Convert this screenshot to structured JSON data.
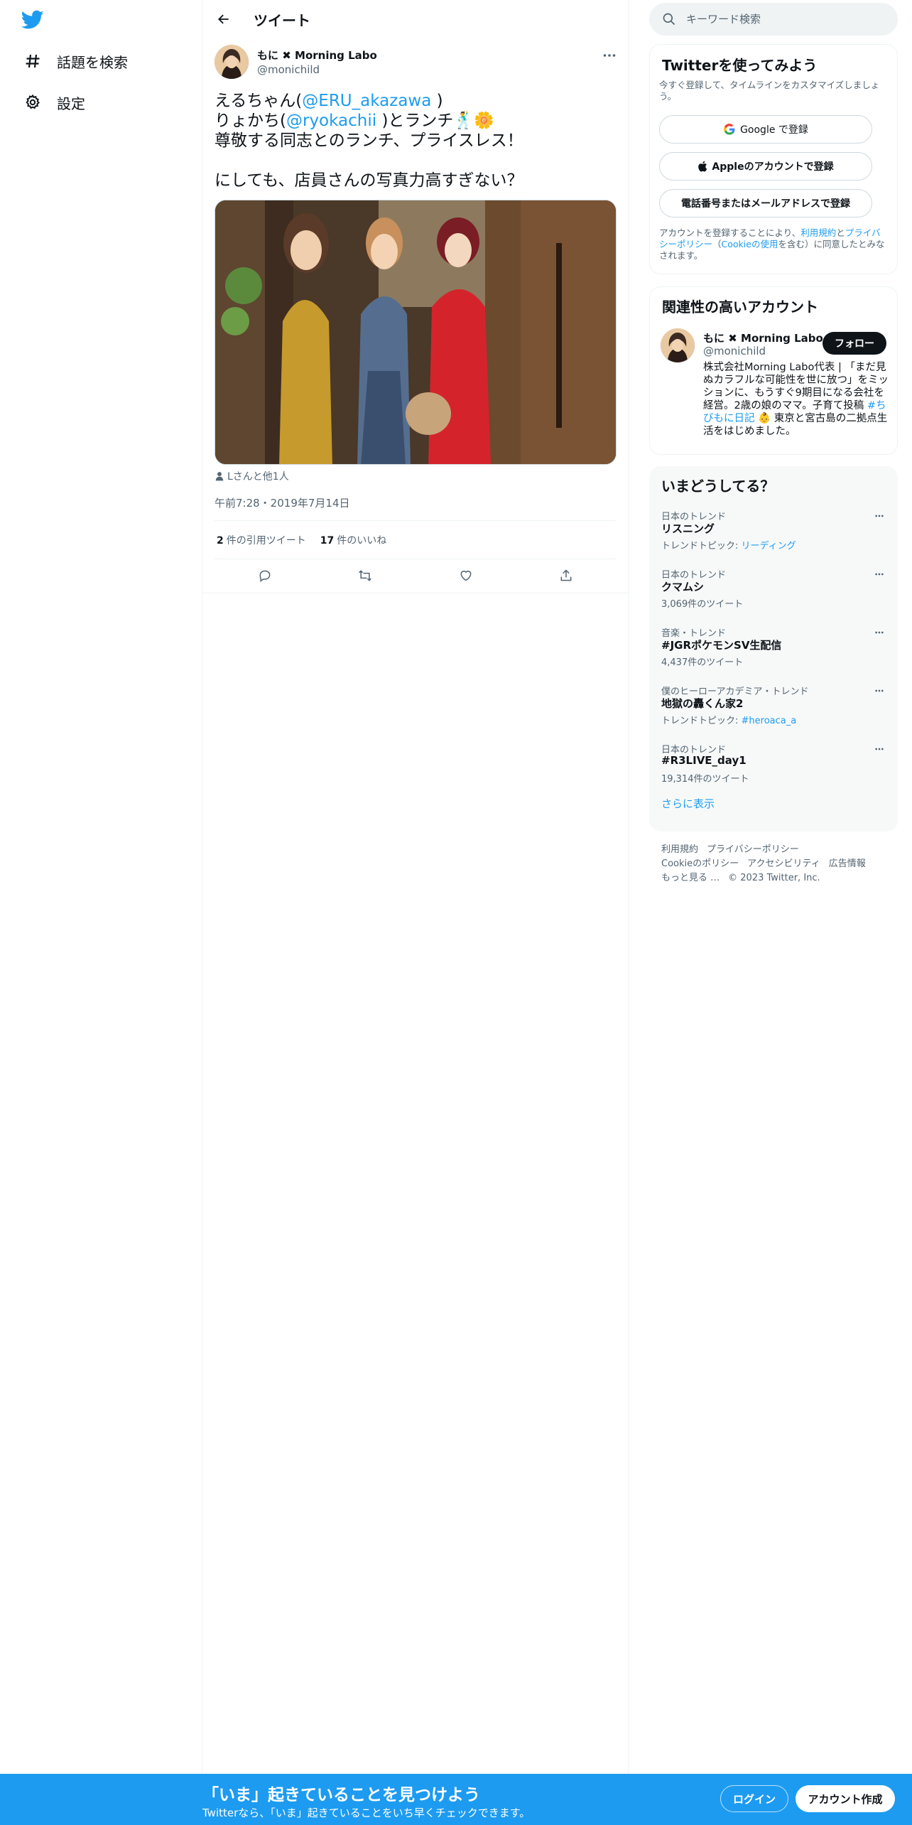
{
  "nav": {
    "logo": "twitter-bird-icon",
    "items": [
      {
        "label": "話題を検索",
        "icon": "hashtag-icon"
      },
      {
        "label": "設定",
        "icon": "gear-icon"
      }
    ]
  },
  "header": {
    "title": "ツイート"
  },
  "tweet": {
    "author_name": "もに ✖ Morning Labo",
    "author_handle": "@monichild",
    "text": {
      "l1_pre": "えるちゃん(",
      "l1_mention": "@ERU_akazawa",
      "l1_post": " )",
      "l2_pre": "りょかち(",
      "l2_mention": "@ryokachii",
      "l2_post": " )とランチ🕺🌼",
      "l3": "尊敬する同志とのランチ、プライスレス！",
      "l4": "にしても、店員さんの写真力高すぎない？"
    },
    "tagged": "Lさんと他1人",
    "timestamp": "午前7:28・2019年7月14日",
    "stats": {
      "quotes_count": "2",
      "quotes_label": "件の引用ツイート",
      "likes_count": "17",
      "likes_label": "件のいいね"
    }
  },
  "search": {
    "placeholder": "キーワード検索"
  },
  "signup_card": {
    "title": "Twitterを使ってみよう",
    "subtitle": "今すぐ登録して、タイムラインをカスタマイズしましょう。",
    "google_label": "Google で登録",
    "apple_label": "Appleのアカウントで登録",
    "phone_label": "電話番号またはメールアドレスで登録",
    "legal_pre": "アカウントを登録することにより、",
    "legal_terms": "利用規約",
    "legal_and": "と",
    "legal_privacy": "プライバシーポリシー",
    "legal_paren_open": "（",
    "legal_cookie": "Cookieの使用",
    "legal_post": "を含む）に同意したとみなされます。"
  },
  "related_card": {
    "title": "関連性の高いアカウント",
    "name": "もに ✖ Morning Labo",
    "handle": "@monichild",
    "follow_label": "フォロー",
    "bio_pre": "株式会社Morning Labo代表 | 「まだ見ぬカラフルな可能性を世に放つ」をミッションに、もうすぐ9期目になる会社を経営。2歳の娘のママ。子育て投稿 ",
    "bio_hashtag": "#ちびもに日記",
    "bio_post": " 👶 東京と宮古島の二拠点生活をはじめました。"
  },
  "trends_card": {
    "title": "いまどうしてる？",
    "items": [
      {
        "category": "日本のトレンド",
        "name": "リスニング",
        "sub_pre": "トレンドトピック: ",
        "sub_link": "リーディング"
      },
      {
        "category": "日本のトレンド",
        "name": "クマムシ",
        "sub_pre": "3,069件のツイート",
        "sub_link": ""
      },
      {
        "category": "音楽・トレンド",
        "name": "#JGRポケモンSV生配信",
        "sub_pre": "4,437件のツイート",
        "sub_link": ""
      },
      {
        "category": "僕のヒーローアカデミア・トレンド",
        "name": "地獄の轟くん家2",
        "sub_pre": "トレンドトピック: ",
        "sub_link": "#heroaca_a"
      },
      {
        "category": "日本のトレンド",
        "name": "#R3LIVE_day1",
        "sub_pre": "19,314件のツイート",
        "sub_link": ""
      }
    ],
    "show_more": "さらに表示"
  },
  "footer": {
    "terms": "利用規約",
    "privacy": "プライバシーポリシー",
    "cookie": "Cookieのポリシー",
    "accessibility": "アクセシビリティ",
    "ads": "広告情報",
    "more": "もっと見る …",
    "copyright": "© 2023 Twitter, Inc."
  },
  "bottom_bar": {
    "title": "「いま」起きていることを見つけよう",
    "subtitle": "Twitterなら、「いま」起きていることをいち早くチェックできます。",
    "login_label": "ログイン",
    "signup_label": "アカウント作成"
  },
  "colors": {
    "accent": "#1d9bf0",
    "bottom_bar": "#1d9bf0",
    "text": "#0f1419",
    "muted": "#536471"
  }
}
